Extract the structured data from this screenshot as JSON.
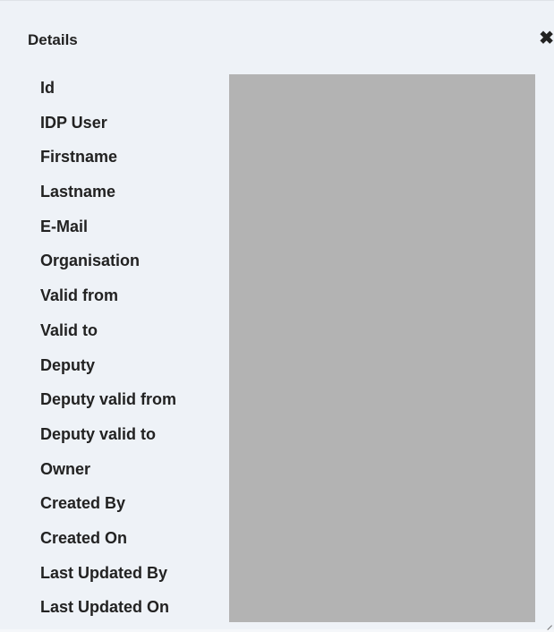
{
  "dialog": {
    "title": "Details",
    "close_glyph": "✖"
  },
  "fields": [
    "Id",
    "IDP User",
    "Firstname",
    "Lastname",
    "E-Mail",
    "Organisation",
    "Valid from",
    "Valid to",
    "Deputy",
    "Deputy valid from",
    "Deputy valid to",
    "Owner",
    "Created By",
    "Created On",
    "Last Updated By",
    "Last Updated On"
  ],
  "colors": {
    "background": "#eef2f7",
    "redaction": "#b3b3b3",
    "text": "#222222"
  },
  "icons": {
    "close": "close-icon",
    "resize": "resize-grip-icon"
  }
}
